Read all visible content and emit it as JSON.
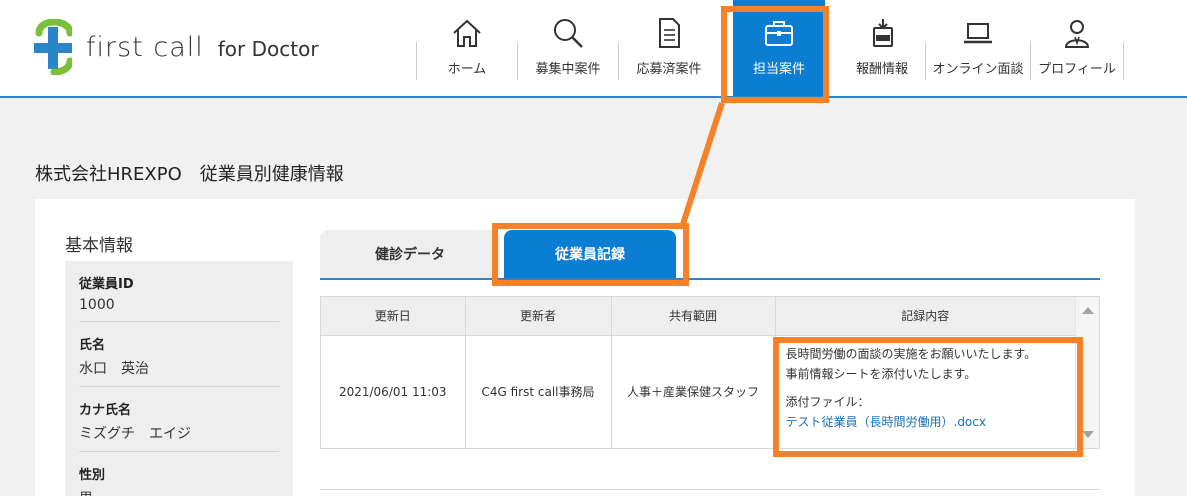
{
  "header": {
    "logo_text": "first call",
    "logo_sub": "for Doctor",
    "nav": [
      {
        "label": "ホーム",
        "icon": "home-icon"
      },
      {
        "label": "募集中案件",
        "icon": "search-icon"
      },
      {
        "label": "応募済案件",
        "icon": "document-icon"
      },
      {
        "label": "担当案件",
        "icon": "briefcase-icon"
      },
      {
        "label": "報酬情報",
        "icon": "pdf-download-icon"
      },
      {
        "label": "オンライン面談",
        "icon": "laptop-icon"
      },
      {
        "label": "プロフィール",
        "icon": "user-icon"
      }
    ],
    "active_nav": "担当案件"
  },
  "page": {
    "title": "株式会社HREXPO　従業員別健康情報"
  },
  "basic": {
    "title": "基本情報",
    "rows": [
      {
        "key": "従業員ID",
        "value": "1000"
      },
      {
        "key": "氏名",
        "value": "水口　英治"
      },
      {
        "key": "カナ氏名",
        "value": "ミズグチ　エイジ"
      },
      {
        "key": "性別",
        "value": "男"
      }
    ]
  },
  "tabs": [
    {
      "label": "健診データ"
    },
    {
      "label": "従業員記録"
    }
  ],
  "table": {
    "headers": [
      "更新日",
      "更新者",
      "共有範囲",
      "記録内容"
    ],
    "row": {
      "date": "2021/06/01 11:03",
      "updater": "C4G first call事務局",
      "scope": "人事＋産業保健スタッフ",
      "content_line1": "長時間労働の面談の実施をお願いいたします。",
      "content_line2": "事前情報シートを添付いたします。",
      "attach_label": "添付ファイル：",
      "attach_file": "テスト従業員（長時間労働用）.docx"
    }
  },
  "colors": {
    "accent": "#0b7dd3",
    "highlight": "#f5822a",
    "logo_blue": "#2b86c9",
    "logo_green": "#7bbf3a"
  }
}
